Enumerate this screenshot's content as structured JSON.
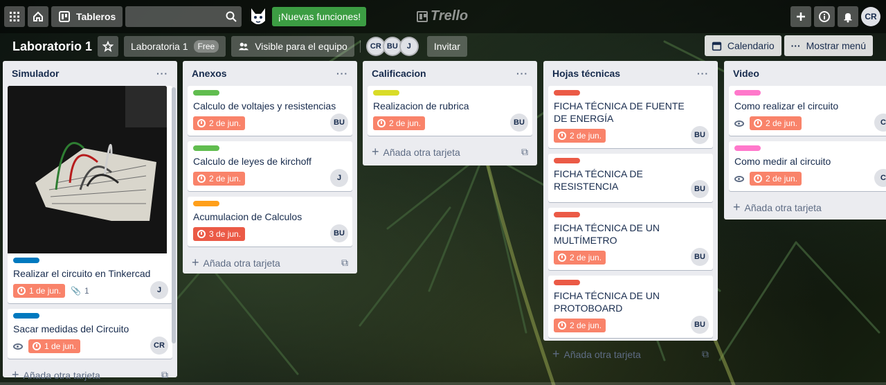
{
  "topbar": {
    "boards_label": "Tableros",
    "news_label": "¡Nuevas funciones!",
    "logo_label": "Trello",
    "user_initials": "CR"
  },
  "boardbar": {
    "title": "Laboratorio 1",
    "workspace": "Laboratoria 1",
    "plan": "Free",
    "visibility": "Visible para el equipo",
    "members": [
      "CR",
      "BU",
      "J"
    ],
    "invite": "Invitar",
    "calendar": "Calendario",
    "menu": "Mostrar menú"
  },
  "add_card_label": "Añada otra tarjeta",
  "lists": [
    {
      "title": "Simulador",
      "cards": [
        {
          "label_color": "#0079bf",
          "title": "Realizar el circuito en Tinkercad",
          "due": "1 de jun.",
          "attachments": "1",
          "member": "J",
          "has_cover": true
        },
        {
          "label_color": "#0079bf",
          "title": "Sacar medidas del Circuito",
          "due": "1 de jun.",
          "member": "CR",
          "watching": true
        }
      ]
    },
    {
      "title": "Anexos",
      "cards": [
        {
          "label_color": "#61bd4f",
          "title": "Calculo de voltajes y resistencias",
          "due": "2 de jun.",
          "member": "BU"
        },
        {
          "label_color": "#61bd4f",
          "title": "Calculo de leyes de kirchoff",
          "due": "2 de jun.",
          "member": "J"
        },
        {
          "label_color": "#ff9f1a",
          "title": "Acumulacion de Calculos",
          "due": "3 de jun.",
          "member": "BU",
          "overdue": true
        }
      ]
    },
    {
      "title": "Calificacion",
      "cards": [
        {
          "label_color": "#d9dc28",
          "title": "Realizacion de rubrica",
          "due": "2 de jun.",
          "member": "BU"
        }
      ]
    },
    {
      "title": "Hojas técnicas",
      "cards": [
        {
          "label_color": "#eb5a46",
          "title": "FICHA TÉCNICA DE FUENTE DE ENERGÍA",
          "due": "2 de jun.",
          "member": "BU"
        },
        {
          "label_color": "#eb5a46",
          "title": "FICHA TÉCNICA DE RESISTENCIA",
          "member": "BU"
        },
        {
          "label_color": "#eb5a46",
          "title": "FICHA TÉCNICA DE UN MULTÍMETRO",
          "due": "2 de jun.",
          "member": "BU"
        },
        {
          "label_color": "#eb5a46",
          "title": "FICHA TÉCNICA DE UN PROTOBOARD",
          "due": "2 de jun.",
          "member": "BU"
        }
      ]
    },
    {
      "title": "Video",
      "cards": [
        {
          "label_color": "#ff78cb",
          "title": "Como realizar el circuito",
          "due": "2 de jun.",
          "member": "C",
          "watching": true
        },
        {
          "label_color": "#ff78cb",
          "title": "Como medir al circuito",
          "due": "2 de jun.",
          "member": "C",
          "watching": true
        }
      ]
    }
  ]
}
